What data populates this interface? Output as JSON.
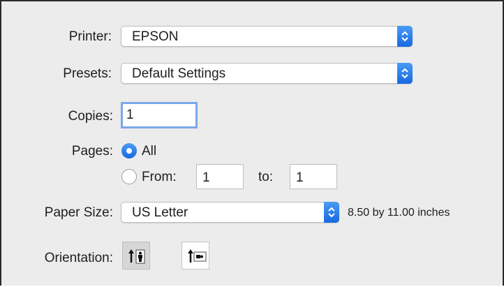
{
  "printer": {
    "label": "Printer:",
    "value": "EPSON"
  },
  "presets": {
    "label": "Presets:",
    "value": "Default Settings"
  },
  "copies": {
    "label": "Copies:",
    "value": "1"
  },
  "pages": {
    "label": "Pages:",
    "all_label": "All",
    "from_label": "From:",
    "from_value": "1",
    "to_label": "to:",
    "to_value": "1",
    "selected": "All"
  },
  "paper_size": {
    "label": "Paper Size:",
    "value": "US Letter",
    "dimensions": "8.50 by 11.00 inches"
  },
  "orientation": {
    "label": "Orientation:",
    "selected": "portrait",
    "options": [
      "portrait-icon",
      "landscape-icon"
    ]
  },
  "colors": {
    "accent": "#1769e0",
    "focus_ring": "#7aa9e6",
    "background": "#ececec"
  }
}
